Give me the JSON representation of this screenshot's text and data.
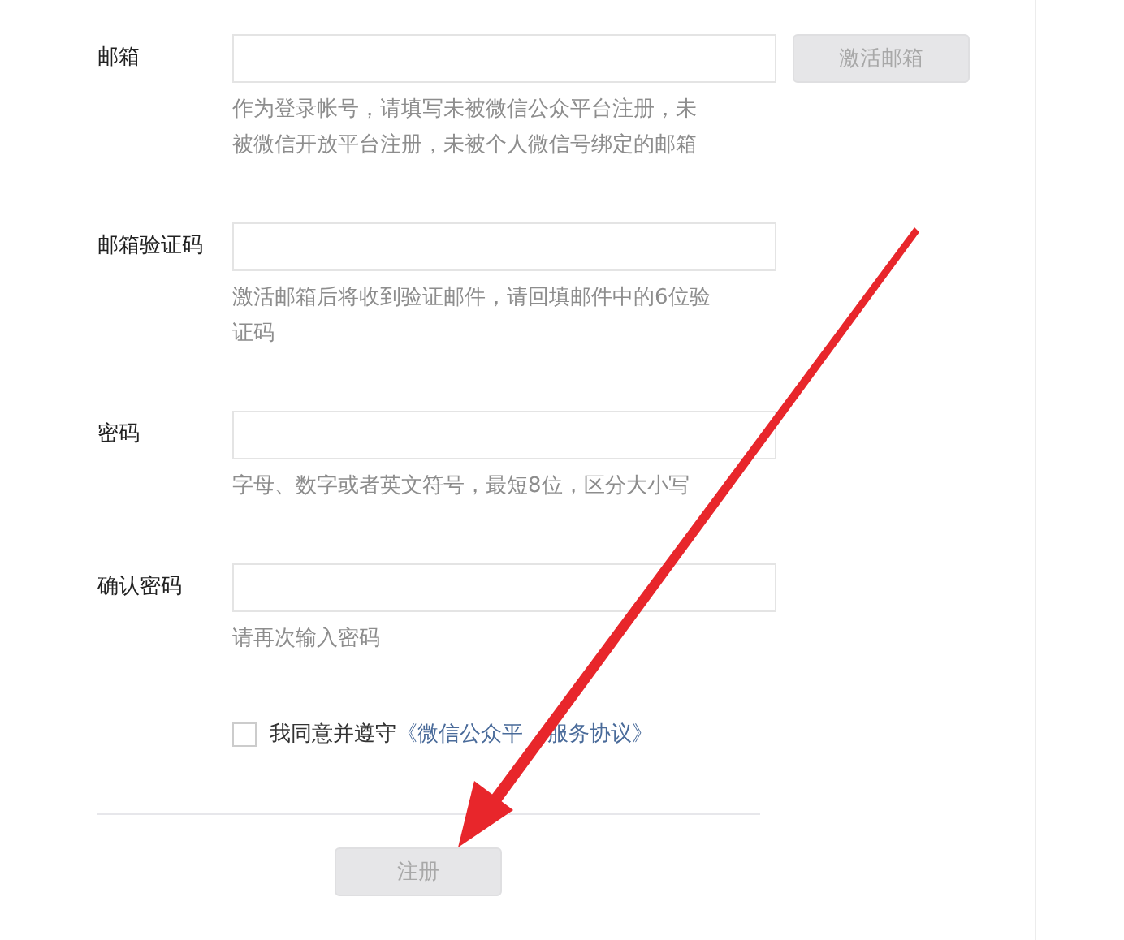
{
  "fields": [
    {
      "label": "邮箱",
      "hint": "作为登录帐号，请填写未被微信公众平台注册，未被微信开放平台注册，未被个人微信号绑定的邮箱",
      "button": {
        "label": "激活邮箱",
        "disabled": true
      }
    },
    {
      "label": "邮箱验证码",
      "hint": "激活邮箱后将收到验证邮件，请回填邮件中的6位验证码"
    },
    {
      "label": "密码",
      "hint": "字母、数字或者英文符号，最短8位，区分大小写"
    },
    {
      "label": "确认密码",
      "hint": "请再次输入密码"
    }
  ],
  "agreement": {
    "checked": false,
    "text": "我同意并遵守",
    "link_parts": [
      "《微信公众平",
      "服务协议》"
    ]
  },
  "submit": {
    "label": "注册",
    "disabled": true
  }
}
